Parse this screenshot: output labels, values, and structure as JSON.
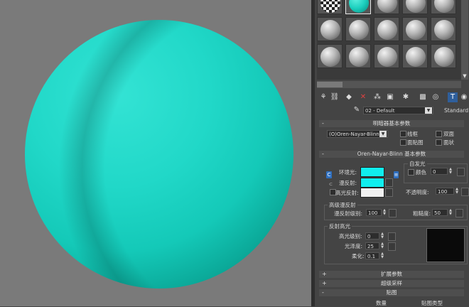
{
  "panel": {
    "material_name": "02 - Default",
    "material_type": "Standard",
    "shader_basic": {
      "title": "明暗器基本参数",
      "shader": "(O)Oren-Nayar-Blinn",
      "wire": "线框",
      "two_sided": "双面",
      "face_map": "面贴图",
      "faceted": "面状"
    },
    "onb_basic": {
      "title": "Oren-Nayar-Blinn 基本参数",
      "self_illum": "自发光",
      "color_label": "颜色",
      "color_value": "0",
      "ambient": "环境光:",
      "diffuse": "漫反射:",
      "specular": "高光反射:",
      "opacity_label": "不透明度:",
      "opacity_value": "100",
      "ambient_color": "#10eeee",
      "diffuse_color": "#10eeee",
      "specular_color": "#f0f0f0"
    },
    "advanced_diffuse": {
      "title": "高级漫反射",
      "diffuse_level_label": "漫反射级别:",
      "diffuse_level_value": "100",
      "roughness_label": "粗糙度:",
      "roughness_value": "50"
    },
    "specular_highlights": {
      "title": "反射高光",
      "level_label": "高光级别:",
      "level_value": "0",
      "gloss_label": "光泽度:",
      "gloss_value": "25",
      "soften_label": "柔化:",
      "soften_value": "0.1"
    },
    "rollouts": {
      "extended": "扩展参数",
      "supersampling": "超级采样",
      "maps": "贴图"
    },
    "maps_header": {
      "amount": "数量",
      "map_type": "贴图类型"
    }
  },
  "icons": [
    "get-material-icon",
    "put-to-scene-icon",
    "assign-icon",
    "reset-icon",
    "make-unique-icon",
    "put-library-icon",
    "effects-channel-icon",
    "show-map-icon",
    "show-end-result-icon",
    "go-parent-icon",
    "go-sibling-icon",
    "eyedropper-icon"
  ]
}
